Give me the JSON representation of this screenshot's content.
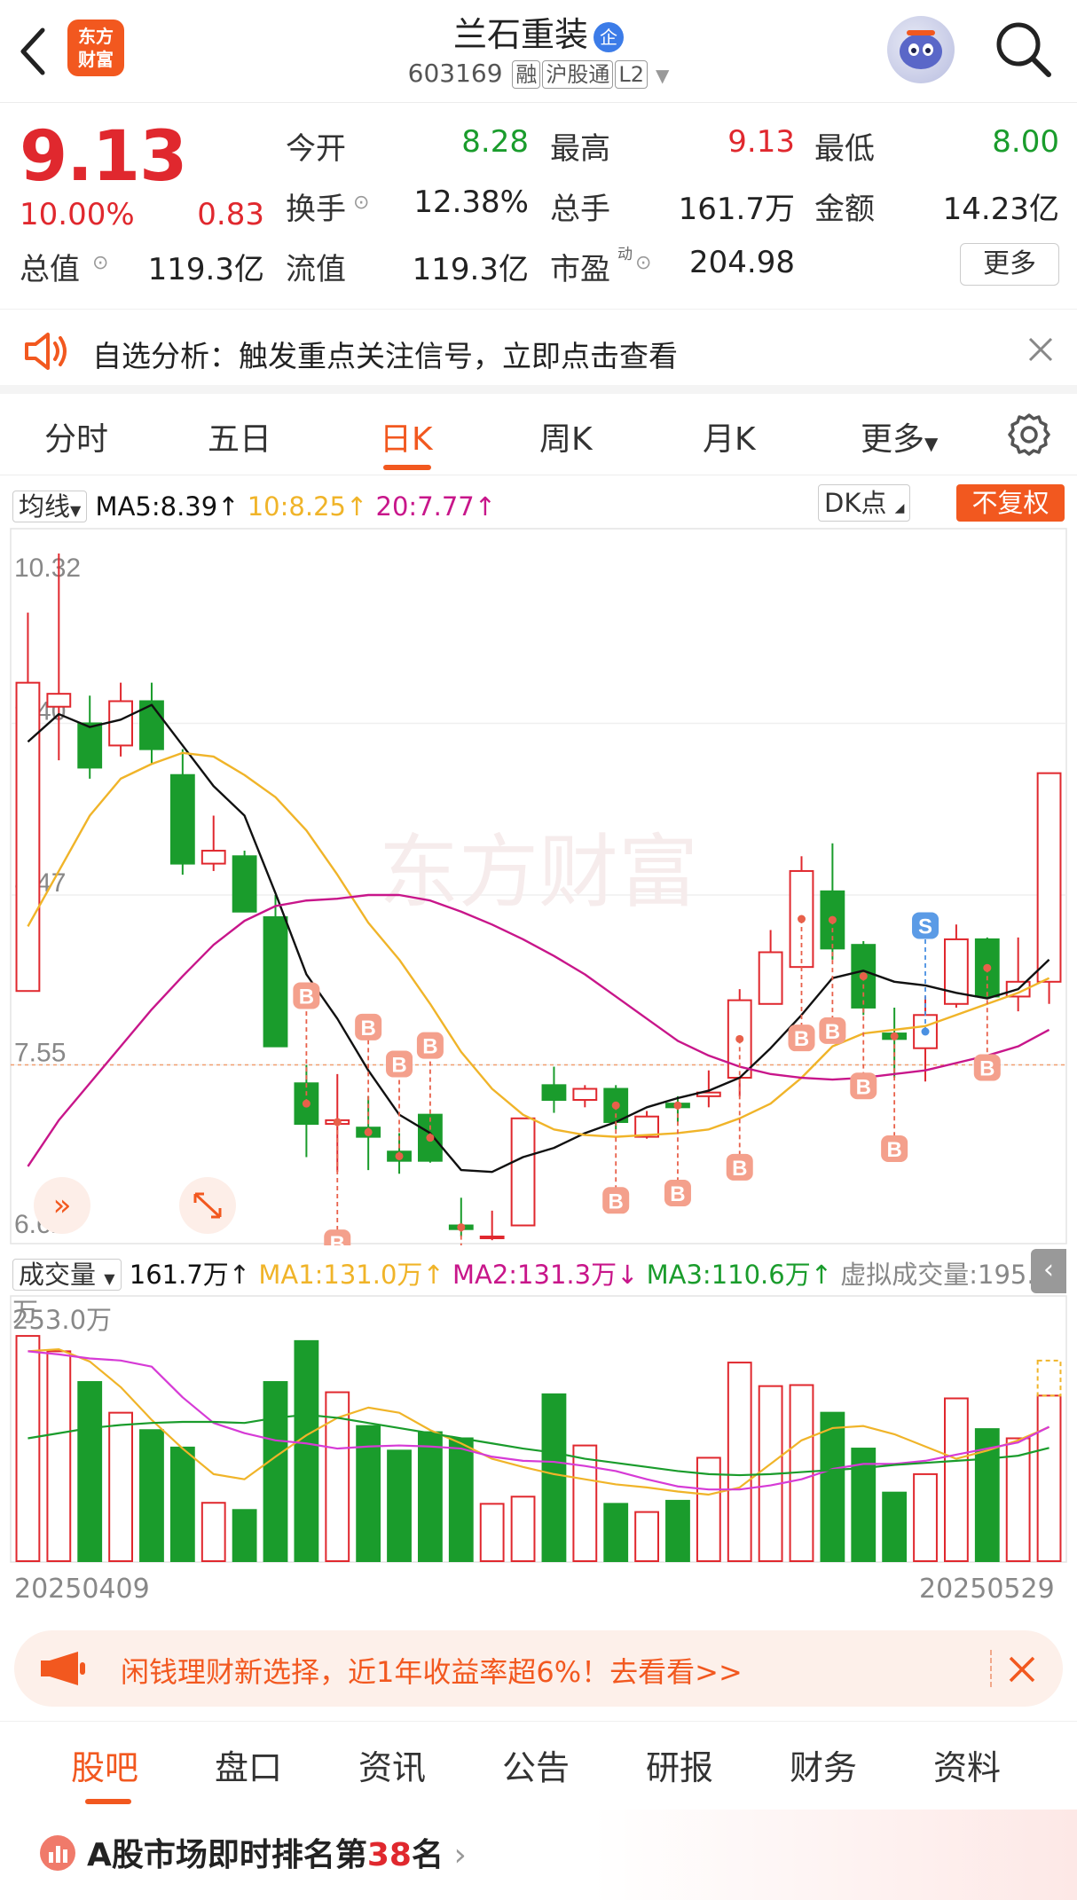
{
  "header": {
    "brand_line1": "东方",
    "brand_line2": "财富",
    "stock_name": "兰石重装",
    "name_badge": "企",
    "stock_code": "603169",
    "tags": [
      "融",
      "沪股通",
      "L2"
    ]
  },
  "quote": {
    "price": "9.13",
    "change_pct": "10.00%",
    "change": "0.83",
    "fields": [
      {
        "label": "今开",
        "value": "8.28",
        "color": "green"
      },
      {
        "label": "最高",
        "value": "9.13",
        "color": "red"
      },
      {
        "label": "最低",
        "value": "8.00",
        "color": "green"
      },
      {
        "label": "换手",
        "value": "12.38%",
        "color": "black"
      },
      {
        "label": "总手",
        "value": "161.7万",
        "color": "black"
      },
      {
        "label": "金额",
        "value": "14.23亿",
        "color": "black"
      },
      {
        "label": "总值",
        "value": "119.3亿",
        "color": "black"
      },
      {
        "label": "流值",
        "value": "119.3亿",
        "color": "black"
      },
      {
        "label": "市盈",
        "value": "204.98",
        "color": "black"
      }
    ],
    "pe_superscript": "动",
    "more_label": "更多"
  },
  "notice": {
    "text": "自选分析：触发重点关注信号，立即点击查看"
  },
  "tabs": [
    "分时",
    "五日",
    "日K",
    "周K",
    "月K",
    "更多"
  ],
  "active_tab": "日K",
  "ma_legend": {
    "selector": "均线",
    "ma5": "MA5:8.39",
    "ma10": "10:8.25",
    "ma20": "20:7.77",
    "dk_label": "DK点",
    "fq_label": "不复权"
  },
  "kline": {
    "y_labels": [
      "10.32",
      "9.40",
      "8.47",
      "7.55",
      "6.62"
    ],
    "watermark": "东方财富",
    "buy_label": "B",
    "sell_label": "S"
  },
  "volume_legend": {
    "selector": "成交量",
    "vol": "161.7万",
    "ma1": "MA1:131.0万",
    "ma2": "MA2:131.3万",
    "ma3": "MA3:110.6万",
    "virtual": "虚拟成交量:195.9万",
    "y_top": "253.0万"
  },
  "dates": {
    "start": "20250409",
    "end": "20250529"
  },
  "banner": {
    "text": "闲钱理财新选择，近1年收益率超6%！去看看>>"
  },
  "bottom_tabs": [
    "股吧",
    "盘口",
    "资讯",
    "公告",
    "研报",
    "财务",
    "资料"
  ],
  "rank": {
    "prefix": "A股市场即时排名第",
    "number": "38",
    "suffix": "名"
  },
  "colors": {
    "accent": "#f2581f",
    "up": "#e0282e",
    "down": "#1a9c2c",
    "ma5": "#111111",
    "ma10": "#f0b429",
    "ma20": "#c8168a"
  },
  "chart_data": {
    "type": "candlestick",
    "x_range": [
      "20250409",
      "20250529"
    ],
    "ylim": [
      6.62,
      10.32
    ],
    "candles": [
      {
        "o": 7.95,
        "h": 10.0,
        "l": 7.95,
        "c": 9.62
      },
      {
        "o": 9.49,
        "h": 10.32,
        "l": 9.2,
        "c": 9.56
      },
      {
        "o": 9.4,
        "h": 9.55,
        "l": 9.1,
        "c": 9.16
      },
      {
        "o": 9.28,
        "h": 9.62,
        "l": 9.22,
        "c": 9.52
      },
      {
        "o": 9.52,
        "h": 9.62,
        "l": 9.18,
        "c": 9.26
      },
      {
        "o": 9.12,
        "h": 9.26,
        "l": 8.58,
        "c": 8.64
      },
      {
        "o": 8.64,
        "h": 8.9,
        "l": 8.6,
        "c": 8.71
      },
      {
        "o": 8.68,
        "h": 8.71,
        "l": 8.38,
        "c": 8.38
      },
      {
        "o": 8.35,
        "h": 8.47,
        "l": 7.65,
        "c": 7.65
      },
      {
        "o": 7.45,
        "h": 7.55,
        "l": 7.05,
        "c": 7.23
      },
      {
        "o": 7.23,
        "h": 7.5,
        "l": 6.97,
        "c": 7.25
      },
      {
        "o": 7.21,
        "h": 7.38,
        "l": 6.98,
        "c": 7.16
      },
      {
        "o": 7.08,
        "h": 7.18,
        "l": 6.96,
        "c": 7.03
      },
      {
        "o": 7.28,
        "h": 7.28,
        "l": 7.02,
        "c": 7.03
      },
      {
        "o": 6.68,
        "h": 6.83,
        "l": 6.62,
        "c": 6.66
      },
      {
        "o": 6.62,
        "h": 6.76,
        "l": 6.6,
        "c": 6.62
      },
      {
        "o": 6.68,
        "h": 7.26,
        "l": 6.68,
        "c": 7.26
      },
      {
        "o": 7.44,
        "h": 7.54,
        "l": 7.29,
        "c": 7.36
      },
      {
        "o": 7.36,
        "h": 7.44,
        "l": 7.32,
        "c": 7.42
      },
      {
        "o": 7.42,
        "h": 7.44,
        "l": 7.2,
        "c": 7.24
      },
      {
        "o": 7.16,
        "h": 7.3,
        "l": 7.15,
        "c": 7.27
      },
      {
        "o": 7.34,
        "h": 7.38,
        "l": 7.24,
        "c": 7.32
      },
      {
        "o": 7.38,
        "h": 7.52,
        "l": 7.32,
        "c": 7.4
      },
      {
        "o": 7.48,
        "h": 7.96,
        "l": 7.38,
        "c": 7.9
      },
      {
        "o": 7.88,
        "h": 8.28,
        "l": 7.88,
        "c": 8.16
      },
      {
        "o": 8.08,
        "h": 8.68,
        "l": 8.08,
        "c": 8.6
      },
      {
        "o": 8.49,
        "h": 8.75,
        "l": 8.12,
        "c": 8.18
      },
      {
        "o": 8.2,
        "h": 8.22,
        "l": 7.82,
        "c": 7.86
      },
      {
        "o": 7.72,
        "h": 7.86,
        "l": 7.48,
        "c": 7.69
      },
      {
        "o": 7.64,
        "h": 7.92,
        "l": 7.46,
        "c": 7.82
      },
      {
        "o": 7.88,
        "h": 8.31,
        "l": 7.86,
        "c": 8.23
      },
      {
        "o": 8.23,
        "h": 8.24,
        "l": 7.92,
        "c": 7.92
      },
      {
        "o": 7.92,
        "h": 8.24,
        "l": 7.84,
        "c": 8.0
      },
      {
        "o": 8.0,
        "h": 8.59,
        "l": 7.88,
        "c": 9.13
      }
    ],
    "ma5": [
      9.3,
      9.45,
      9.38,
      9.42,
      9.5,
      9.28,
      9.06,
      8.9,
      8.48,
      8.04,
      7.8,
      7.52,
      7.28,
      7.18,
      6.98,
      6.97,
      7.05,
      7.1,
      7.18,
      7.24,
      7.32,
      7.37,
      7.41,
      7.48,
      7.64,
      7.82,
      8.02,
      8.06,
      8.0,
      7.98,
      7.94,
      7.91,
      7.96,
      8.12
    ],
    "ma10": [
      8.3,
      8.6,
      8.9,
      9.1,
      9.18,
      9.24,
      9.22,
      9.12,
      9.0,
      8.82,
      8.58,
      8.32,
      8.12,
      7.88,
      7.62,
      7.42,
      7.28,
      7.2,
      7.17,
      7.16,
      7.17,
      7.18,
      7.2,
      7.26,
      7.34,
      7.48,
      7.65,
      7.72,
      7.74,
      7.76,
      7.82,
      7.88,
      7.94,
      8.02
    ],
    "ma20": [
      7.0,
      7.25,
      7.45,
      7.65,
      7.85,
      8.03,
      8.2,
      8.33,
      8.41,
      8.44,
      8.45,
      8.47,
      8.47,
      8.44,
      8.38,
      8.31,
      8.23,
      8.14,
      8.04,
      7.92,
      7.8,
      7.68,
      7.6,
      7.54,
      7.5,
      7.48,
      7.47,
      7.48,
      7.5,
      7.52,
      7.56,
      7.6,
      7.65,
      7.74
    ],
    "signals": [
      {
        "i": 9,
        "type": "B",
        "above": true
      },
      {
        "i": 10,
        "type": "B",
        "above": false
      },
      {
        "i": 11,
        "type": "B",
        "above": true
      },
      {
        "i": 12,
        "type": "B",
        "above": true
      },
      {
        "i": 13,
        "type": "B",
        "above": true
      },
      {
        "i": 14,
        "type": "B",
        "above": false
      },
      {
        "i": 19,
        "type": "B",
        "above": false
      },
      {
        "i": 21,
        "type": "B",
        "above": false
      },
      {
        "i": 23,
        "type": "B",
        "above": false
      },
      {
        "i": 25,
        "type": "B",
        "above": false
      },
      {
        "i": 26,
        "type": "B",
        "above": false
      },
      {
        "i": 27,
        "type": "B",
        "above": false
      },
      {
        "i": 28,
        "type": "B",
        "above": false
      },
      {
        "i": 29,
        "type": "S",
        "above": true
      },
      {
        "i": 31,
        "type": "B",
        "above": false
      }
    ],
    "volume": {
      "ylim": [
        0,
        253.0
      ],
      "values": [
        220,
        205,
        175,
        145,
        128,
        111,
        57,
        50,
        175,
        215,
        165,
        132,
        108,
        126,
        120,
        56,
        63,
        163,
        113,
        56,
        48,
        59,
        101,
        194,
        171,
        172,
        145,
        110,
        67,
        85,
        159,
        129,
        120,
        161.7
      ],
      "virtual_value": 195.9,
      "ma1": [
        205,
        207,
        195,
        170,
        138,
        110,
        85,
        80,
        102,
        123,
        140,
        150,
        145,
        128,
        115,
        100,
        92,
        85,
        80,
        75,
        72,
        68,
        65,
        72,
        95,
        118,
        130,
        132,
        124,
        112,
        100,
        108,
        118,
        131
      ],
      "ma2": [
        205,
        202,
        198,
        196,
        190,
        160,
        135,
        125,
        118,
        115,
        110,
        112,
        113,
        112,
        110,
        102,
        98,
        97,
        93,
        88,
        80,
        73,
        70,
        70,
        74,
        80,
        90,
        95,
        95,
        98,
        104,
        110,
        116,
        131.3
      ],
      "ma3": [
        120,
        125,
        130,
        133,
        135,
        136,
        136,
        135,
        140,
        143,
        140,
        135,
        130,
        125,
        120,
        115,
        110,
        106,
        100,
        96,
        92,
        88,
        85,
        84,
        85,
        87,
        89,
        91,
        94,
        96,
        98,
        100,
        103,
        110.6
      ]
    }
  }
}
